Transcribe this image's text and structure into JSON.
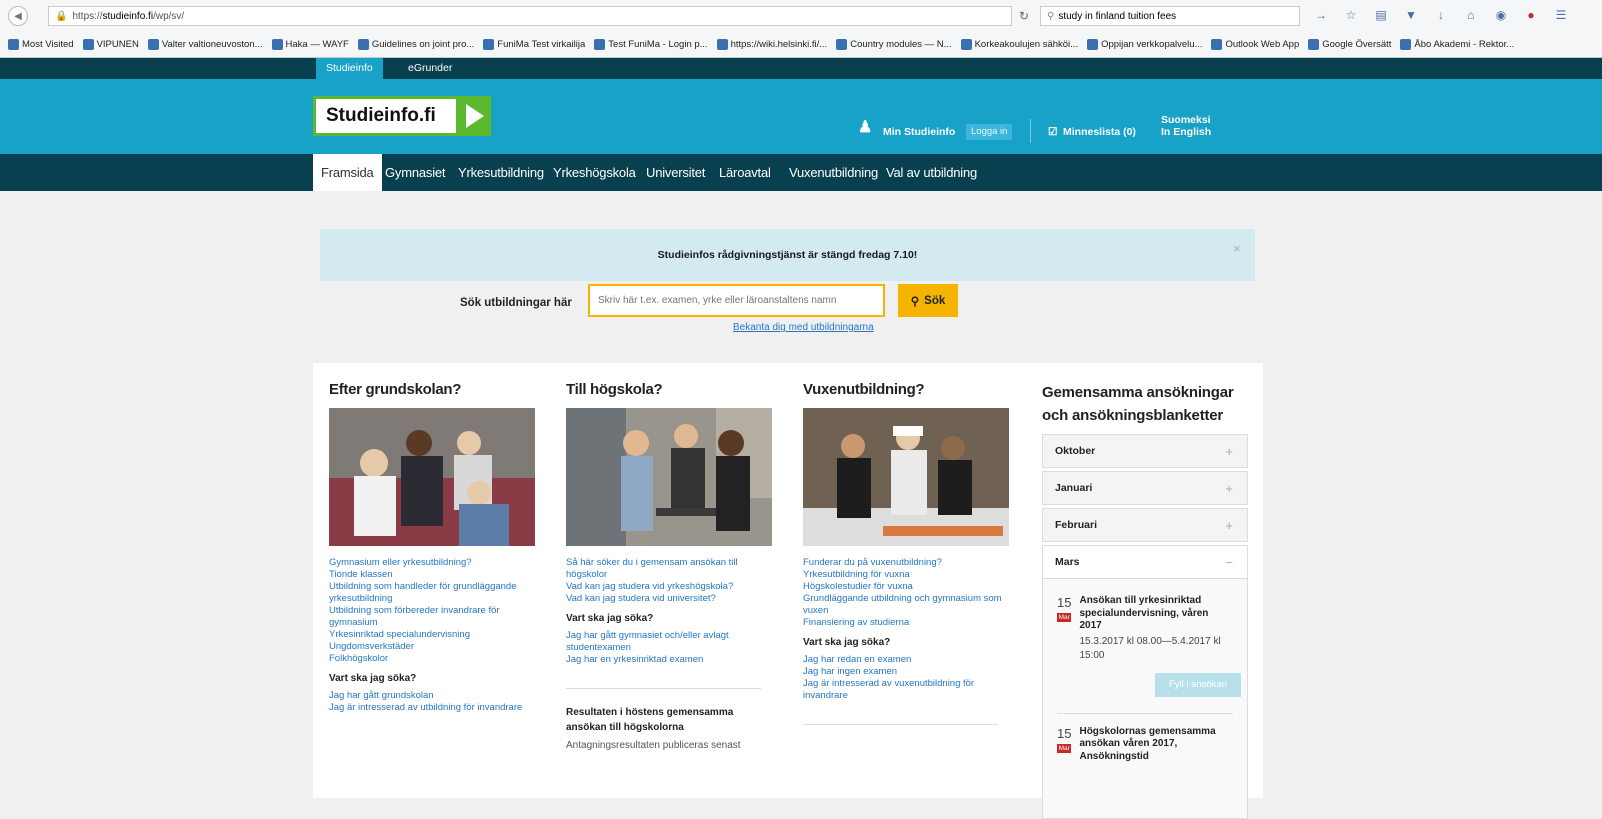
{
  "browser": {
    "url_prefix": "https://",
    "url_domain": "studieinfo.fi",
    "url_path": "/wp/sv/",
    "search": "study in finland tuition fees"
  },
  "bookmarks": [
    "Most Visited",
    "VIPUNEN",
    "Valter valtioneuvoston...",
    "Haka — WAYF",
    "Guidelines on joint pro...",
    "FuniMa Test virkailija",
    "Test FuniMa - Login p...",
    "https://wiki.helsinki.fi/...",
    "Country modules — N...",
    "Korkeakoulujen sähköi...",
    "Oppijan verkkopalvelu...",
    "Outlook Web App",
    "Google Översätt",
    "Åbo Akademi - Rektor..."
  ],
  "topnav": {
    "studieinfo": "Studieinfo",
    "egrunder": "eGrunder"
  },
  "header": {
    "logo": "Studieinfo.fi",
    "min_studieinfo": "Min Studieinfo",
    "login": "Logga in",
    "minneslista": "Minneslista (0)",
    "suomeksi": "Suomeksi",
    "english": "In English"
  },
  "mainnav": [
    "Framsida",
    "Gymnasiet",
    "Yrkesutbildning",
    "Yrkeshögskola",
    "Universitet",
    "Läroavtal",
    "Vuxenutbildning",
    "Val av utbildning"
  ],
  "notice": "Studieinfos rådgivningstjänst är stängd fredag 7.10!",
  "search": {
    "label": "Sök utbildningar här",
    "placeholder": "Skriv här t.ex. examen, yrke eller läroanstaltens namn",
    "button": "Sök",
    "link": "Bekanta dig med utbildningarna"
  },
  "col1": {
    "title": "Efter grundskolan?",
    "links": [
      "Gymnasium eller yrkesutbildning?",
      "Tionde klassen",
      "Utbildning som handleder för grundläggande yrkesutbildning",
      "Utbildning som förbereder invandrare för gymnasium",
      "Yrkesinriktad specialundervisning",
      "Ungdomsverkstäder",
      "Folkhögskolor"
    ],
    "sub": "Vart ska jag söka?",
    "links2": [
      "Jag har gått grundskolan",
      "Jag är intresserad av utbildning för invandrare"
    ]
  },
  "col2": {
    "title": "Till högskola?",
    "links": [
      "Så här söker du i gemensam ansökan till högskolor",
      "Vad kan jag studera vid yrkeshögskola?",
      "Vad kan jag studera vid universitet?"
    ],
    "sub": "Vart ska jag söka?",
    "links2": [
      "Jag har gått gymnasiet och/eller avlagt studentexamen",
      "Jag har en yrkesinriktad examen"
    ],
    "news_title": "Resultaten i höstens gemensamma ansökan till högskolorna",
    "news_text": "Antagningsresultaten publiceras senast"
  },
  "col3": {
    "title": "Vuxenutbildning?",
    "links": [
      "Funderar du på vuxenutbildning?",
      "Yrkesutbildning för vuxna",
      "Högskolestudier för vuxna",
      "Grundläggande utbildning och gymnasium som vuxen",
      "Finansiering av studierna"
    ],
    "sub": "Vart ska jag söka?",
    "links2": [
      "Jag har redan en examen",
      "Jag har ingen examen",
      "Jag är intresserad av vuxenutbildning för invandrare"
    ]
  },
  "col4": {
    "title": "Gemensamma ansökningar och ansökningsblanketter",
    "months": [
      "Oktober",
      "Januari",
      "Februari",
      "Mars"
    ],
    "events": [
      {
        "day": "15",
        "month": "Mar",
        "title": "Ansökan till yrkesinriktad specialundervisning, våren 2017",
        "time": "15.3.2017 kl 08.00—5.4.2017 kl 15:00",
        "button": "Fyll i ansökan"
      },
      {
        "day": "15",
        "month": "Mar",
        "title": "Högskolornas gemensamma ansökan våren 2017, Ansökningstid"
      }
    ]
  }
}
